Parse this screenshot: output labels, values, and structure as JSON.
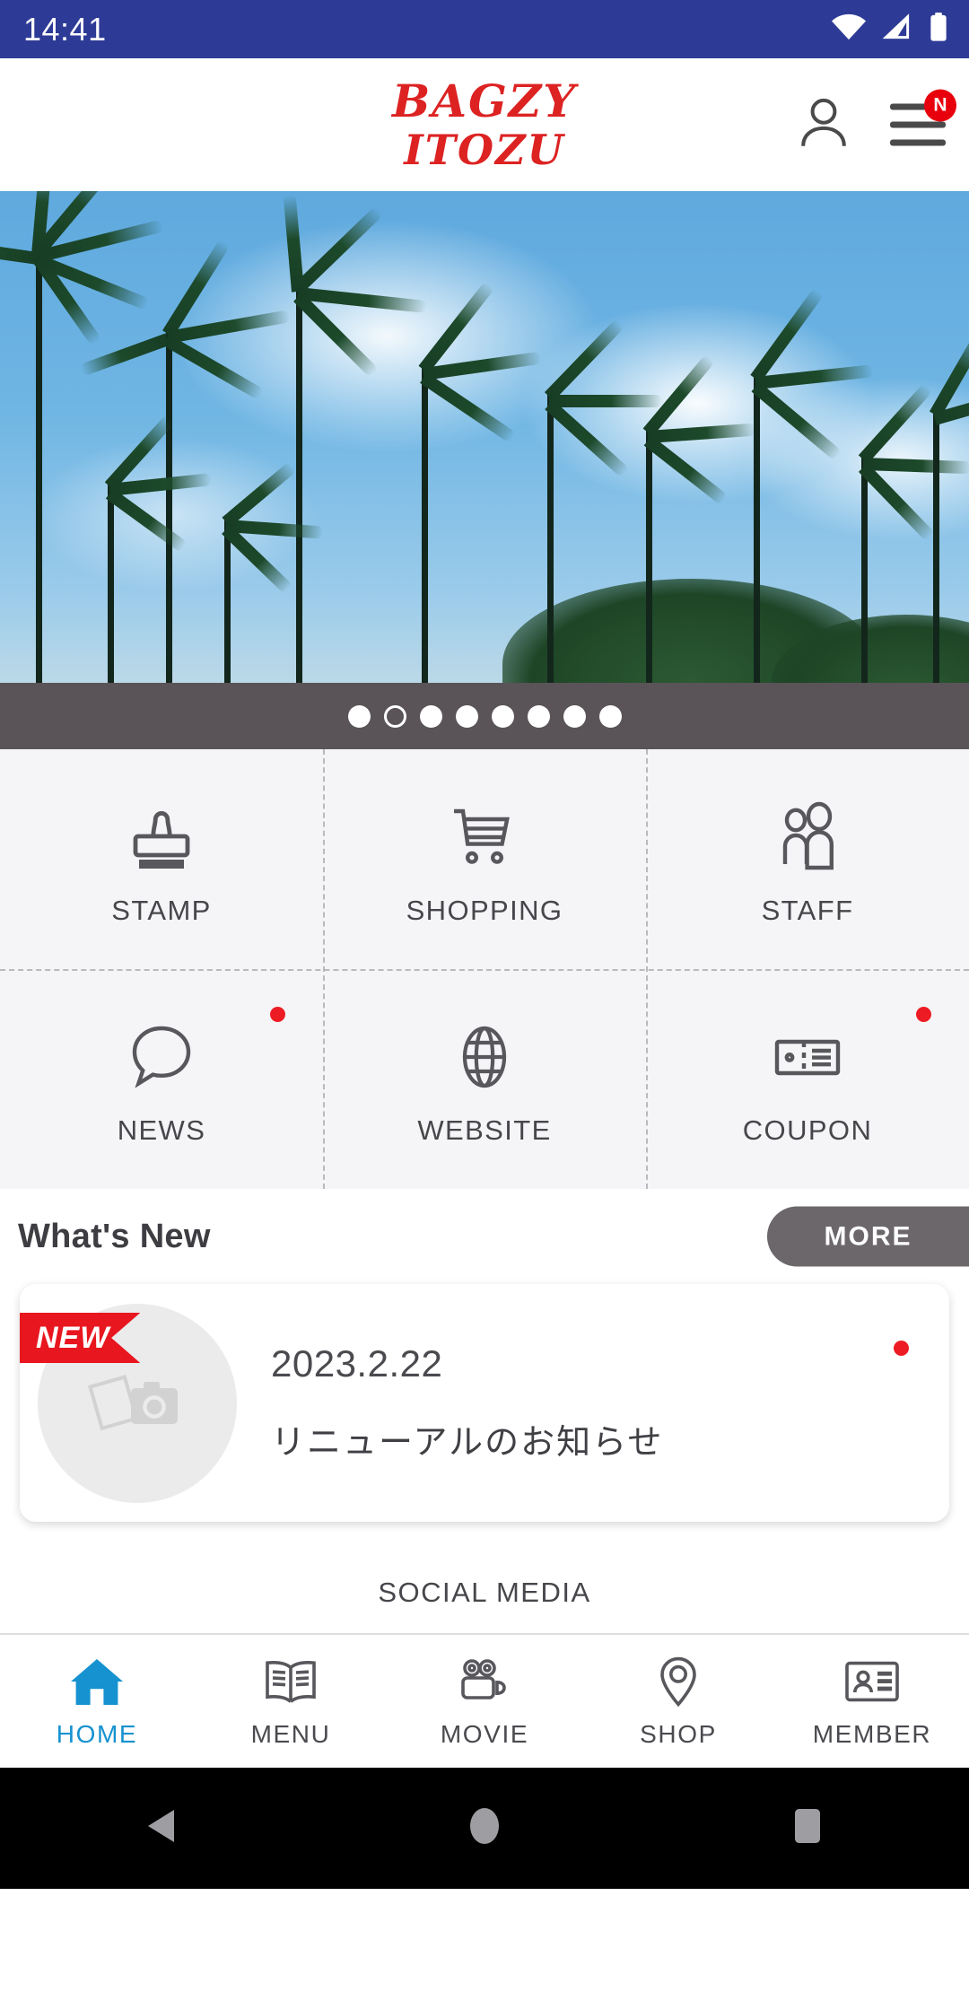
{
  "status_bar": {
    "time": "14:41",
    "icons": [
      "wifi-icon",
      "cellular-signal-icon",
      "battery-icon"
    ]
  },
  "header": {
    "logo_line1": "BAGZY",
    "logo_line2": "ITOZU",
    "account_icon": "person-icon",
    "menu_icon": "hamburger-menu-icon",
    "menu_badge": "N"
  },
  "hero": {
    "alt": "tropical palm trees and blue sky",
    "total_slides": 8,
    "active_slide": 2
  },
  "grid_menu": {
    "items": [
      {
        "label": "STAMP",
        "icon": "stamp-icon",
        "badge": false
      },
      {
        "label": "SHOPPING",
        "icon": "shopping-cart-icon",
        "badge": false
      },
      {
        "label": "STAFF",
        "icon": "people-icon",
        "badge": false
      },
      {
        "label": "NEWS",
        "icon": "speech-bubble-icon",
        "badge": true
      },
      {
        "label": "WEBSITE",
        "icon": "globe-icon",
        "badge": false
      },
      {
        "label": "COUPON",
        "icon": "ticket-icon",
        "badge": true
      }
    ]
  },
  "whats_new": {
    "title": "What's New",
    "more_label": "MORE",
    "items": [
      {
        "ribbon": "NEW",
        "date": "2023.2.22",
        "headline": "リニューアルのお知らせ",
        "thumb_icon": "photo-placeholder-icon",
        "unread": true
      }
    ]
  },
  "social_media": {
    "label": "SOCIAL MEDIA"
  },
  "bottom_nav": {
    "active_index": 0,
    "items": [
      {
        "label": "HOME",
        "icon": "home-icon"
      },
      {
        "label": "MENU",
        "icon": "open-book-icon"
      },
      {
        "label": "MOVIE",
        "icon": "video-camera-icon"
      },
      {
        "label": "SHOP",
        "icon": "map-pin-icon"
      },
      {
        "label": "MEMBER",
        "icon": "id-card-icon"
      }
    ]
  },
  "system_nav": {
    "back": "back-triangle-icon",
    "home": "home-circle-icon",
    "recents": "recents-square-icon"
  },
  "colors": {
    "status_bar": "#2E3B96",
    "logo_red": "#DD2222",
    "badge_red": "#E8000D",
    "accent_blue": "#1592CF",
    "more_gray": "#6B676B",
    "grid_bg": "#F5F5F7"
  }
}
